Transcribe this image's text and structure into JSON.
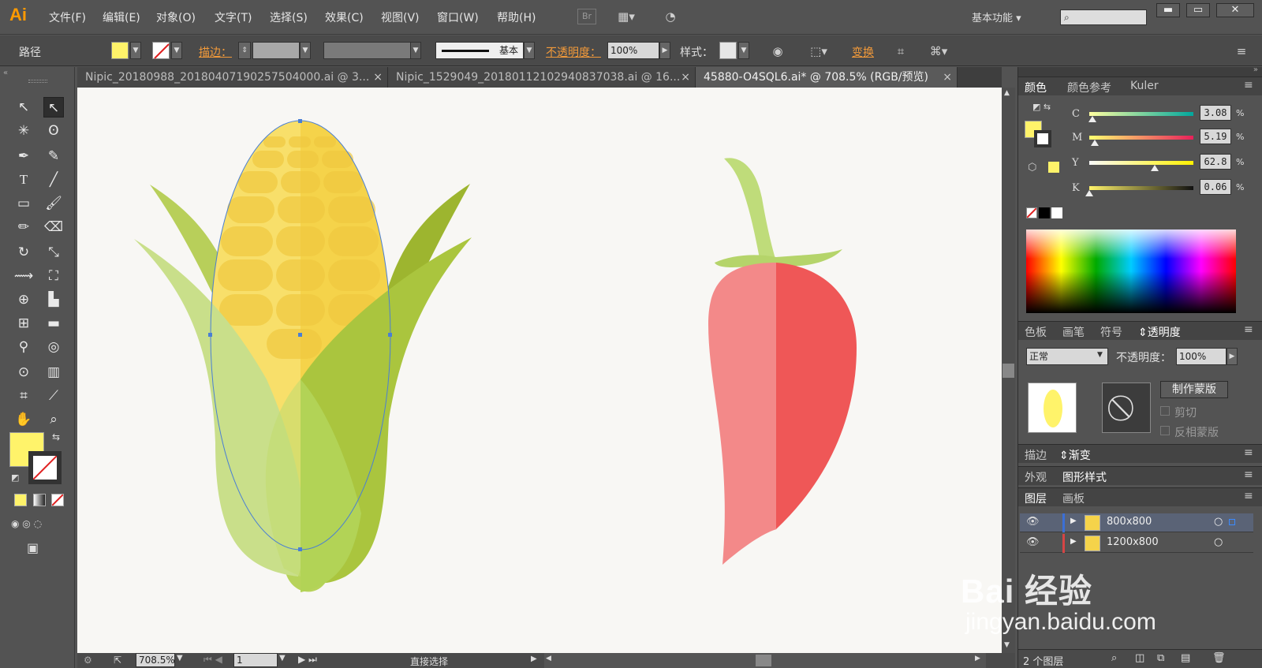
{
  "app": {
    "logo": "Ai"
  },
  "menu": [
    "文件(F)",
    "编辑(E)",
    "对象(O)",
    "文字(T)",
    "选择(S)",
    "效果(C)",
    "视图(V)",
    "窗口(W)",
    "帮助(H)"
  ],
  "toolbar_icons": [
    "bridge-icon",
    "arrange-documents-icon",
    "gpu-performance-icon"
  ],
  "bridge_label": "Br",
  "workspace": "基本功能",
  "window_controls": {
    "minimize": "▬",
    "maximize": "▭",
    "close": "✕"
  },
  "control": {
    "path_label": "路径",
    "stroke_label": "描边：",
    "stroke_profile": "基本",
    "opacity_label": "不透明度：",
    "opacity_value": "100%",
    "style_label": "样式：",
    "transform_label": "变换"
  },
  "colors": {
    "fill": "#fff36a",
    "accent_orange": "#f29a3a",
    "canvas_bg": "#f8f7f4"
  },
  "tabs": [
    {
      "label": "Nipic_20180988_20180407190257504000.ai @ 3...",
      "active": false
    },
    {
      "label": "Nipic_1529049_20180112102940837038.ai @ 16...",
      "active": false
    },
    {
      "label": "45880-O4SQL6.ai* @ 708.5% (RGB/预览)",
      "active": true
    }
  ],
  "tab_close": "×",
  "status": {
    "zoom": "708.5%",
    "artboard": "1",
    "tool_name": "直接选择"
  },
  "color_panel": {
    "tabs": [
      "颜色",
      "颜色参考",
      "Kuler"
    ],
    "channels": [
      {
        "label": "C",
        "value": "3.08",
        "pct": "%",
        "level": 0.03
      },
      {
        "label": "M",
        "value": "5.19",
        "pct": "%",
        "level": 0.05
      },
      {
        "label": "Y",
        "value": "62.8",
        "pct": "%",
        "level": 0.63
      },
      {
        "label": "K",
        "value": "0.06",
        "pct": "%",
        "level": 0.0
      }
    ]
  },
  "transparency_panel": {
    "tabs": [
      "色板",
      "画笔",
      "符号",
      "透明度"
    ],
    "blend_mode": "正常",
    "opacity_label": "不透明度：",
    "opacity_value": "100%",
    "make_mask": "制作蒙版",
    "clip": "剪切",
    "invert_mask": "反相蒙版"
  },
  "stroke_panel": {
    "tabs": [
      "描边",
      "渐变"
    ]
  },
  "appearance_panel": {
    "tabs": [
      "外观",
      "图形样式"
    ]
  },
  "layers_panel": {
    "tabs": [
      "图层",
      "画板"
    ],
    "layers": [
      {
        "name": "800x800"
      },
      {
        "name": "1200x800"
      }
    ],
    "count": "2 个图层"
  },
  "watermark": {
    "brand": "Bai 经验",
    "url": "jingyan.baidu.com"
  }
}
